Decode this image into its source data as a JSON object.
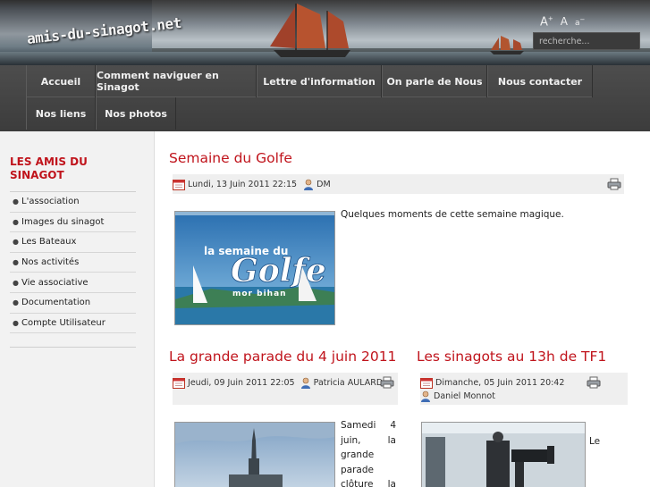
{
  "site": {
    "logo_text": "amis-du-sinagot.net",
    "font_tools": {
      "increase": "A",
      "reset": "A",
      "decrease": "a"
    },
    "search_placeholder": "recherche..."
  },
  "nav": {
    "row1": [
      "Accueil",
      "Comment naviguer en Sinagot",
      "Lettre d'information",
      "On parle de Nous",
      "Nous contacter"
    ],
    "row2": [
      "Nos liens",
      "Nos photos"
    ]
  },
  "sidebar": {
    "title": "LES AMIS DU SINAGOT",
    "items": [
      "L'association",
      "Images du sinagot",
      "Les Bateaux",
      "Nos activités",
      "Vie associative",
      "Documentation",
      "Compte Utilisateur"
    ]
  },
  "articles": [
    {
      "title": "Semaine du Golfe",
      "date": "Lundi, 13 Juin 2011 22:15",
      "author": "DM",
      "text": "Quelques moments de cette semaine magique.",
      "image_text": {
        "line1": "la semaine du",
        "line2": "Golfe",
        "line3": "mor bihan"
      }
    },
    {
      "title": "La grande parade du 4 juin 2011",
      "date": "Jeudi, 09 Juin 2011 22:05",
      "author": "Patricia AULARD",
      "text_lines": [
        [
          "Samedi",
          "4"
        ],
        [
          "juin,",
          "la"
        ],
        [
          "grande",
          ""
        ],
        [
          "parade",
          ""
        ],
        [
          "clôture",
          "la"
        ]
      ]
    },
    {
      "title": "Les sinagots au 13h de TF1",
      "date": "Dimanche, 05 Juin 2011 20:42",
      "author": "Daniel Monnot",
      "text": "Le"
    }
  ]
}
